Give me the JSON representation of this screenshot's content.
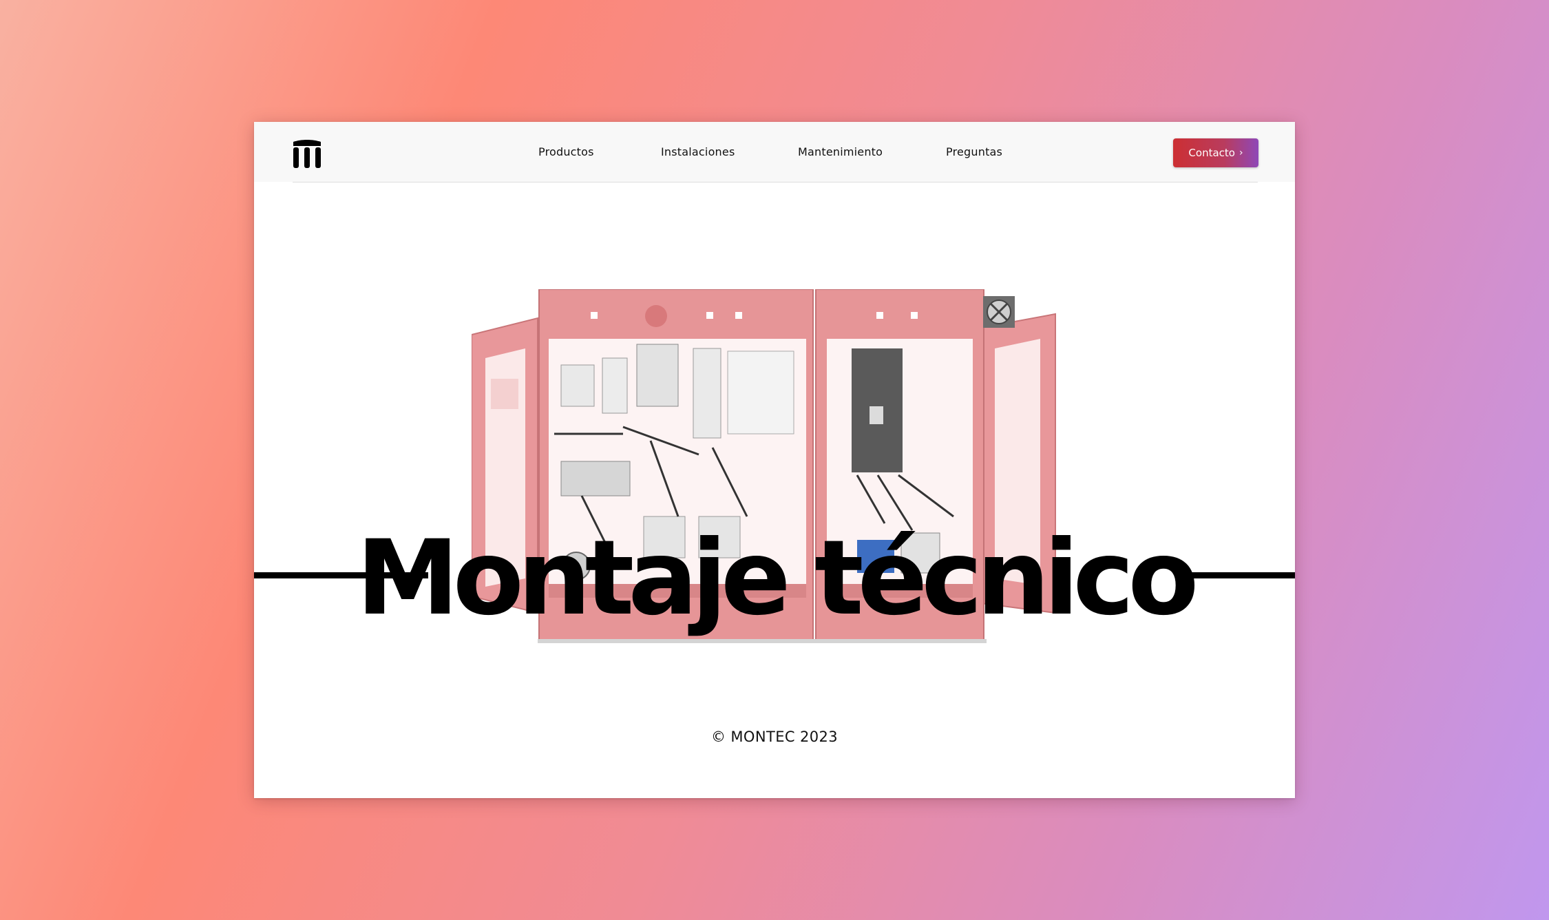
{
  "brand": {
    "logo_icon": "montec-m-logo-icon"
  },
  "nav": {
    "items": [
      {
        "label": "Productos"
      },
      {
        "label": "Instalaciones"
      },
      {
        "label": "Mantenimiento"
      },
      {
        "label": "Preguntas"
      }
    ],
    "contact_label": "Contacto",
    "contact_icon": "chevron-right-icon"
  },
  "hero": {
    "title": "Montaje técnico",
    "image": "electrical-control-cabinet-image"
  },
  "footer": {
    "copyright": "© MONTEC 2023"
  },
  "colors": {
    "background_gradient": [
      "#f9b1a1",
      "#fd8876",
      "#f08b95",
      "#da8cbf",
      "#c097ee"
    ],
    "button_gradient": [
      "#cc2f33",
      "#8e48b8"
    ],
    "cabinet": "#e8989a"
  }
}
